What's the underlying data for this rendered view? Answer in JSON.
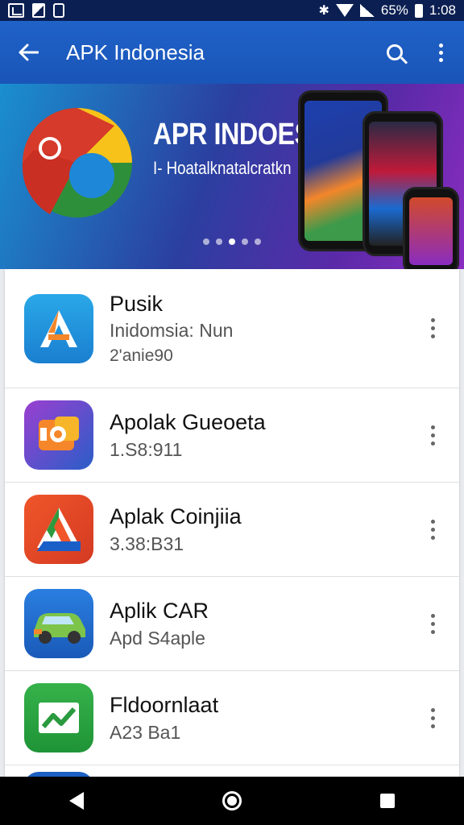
{
  "status_bar": {
    "battery_text": "65%",
    "time": "1:08"
  },
  "app_bar": {
    "title": "APK Indonesia"
  },
  "banner": {
    "title": "APR INDOESIA",
    "subtitle": "I- Hoatalknatalcratkn",
    "page_count": 5,
    "active_page": 3
  },
  "apps": [
    {
      "name": "Pusik",
      "line1": "Inidomsia: Nun",
      "line2": "2'anie90",
      "icon": "letter-a-icon"
    },
    {
      "name": "Apolak Gueoeta",
      "line1": "1.S8:911",
      "icon": "photo-camera-icon"
    },
    {
      "name": "Aplak Coinjiia",
      "line1": "3.38:B31",
      "icon": "drive-triangle-icon"
    },
    {
      "name": "Aplik CAR",
      "line1": "Apd S4aple",
      "icon": "car-icon"
    },
    {
      "name": "Fldoornlaat",
      "line1": "A23 Ba1",
      "icon": "chart-arrow-icon"
    }
  ],
  "colors": {
    "app_bar": "#1f62c8",
    "status_bar": "#0b1f52"
  }
}
